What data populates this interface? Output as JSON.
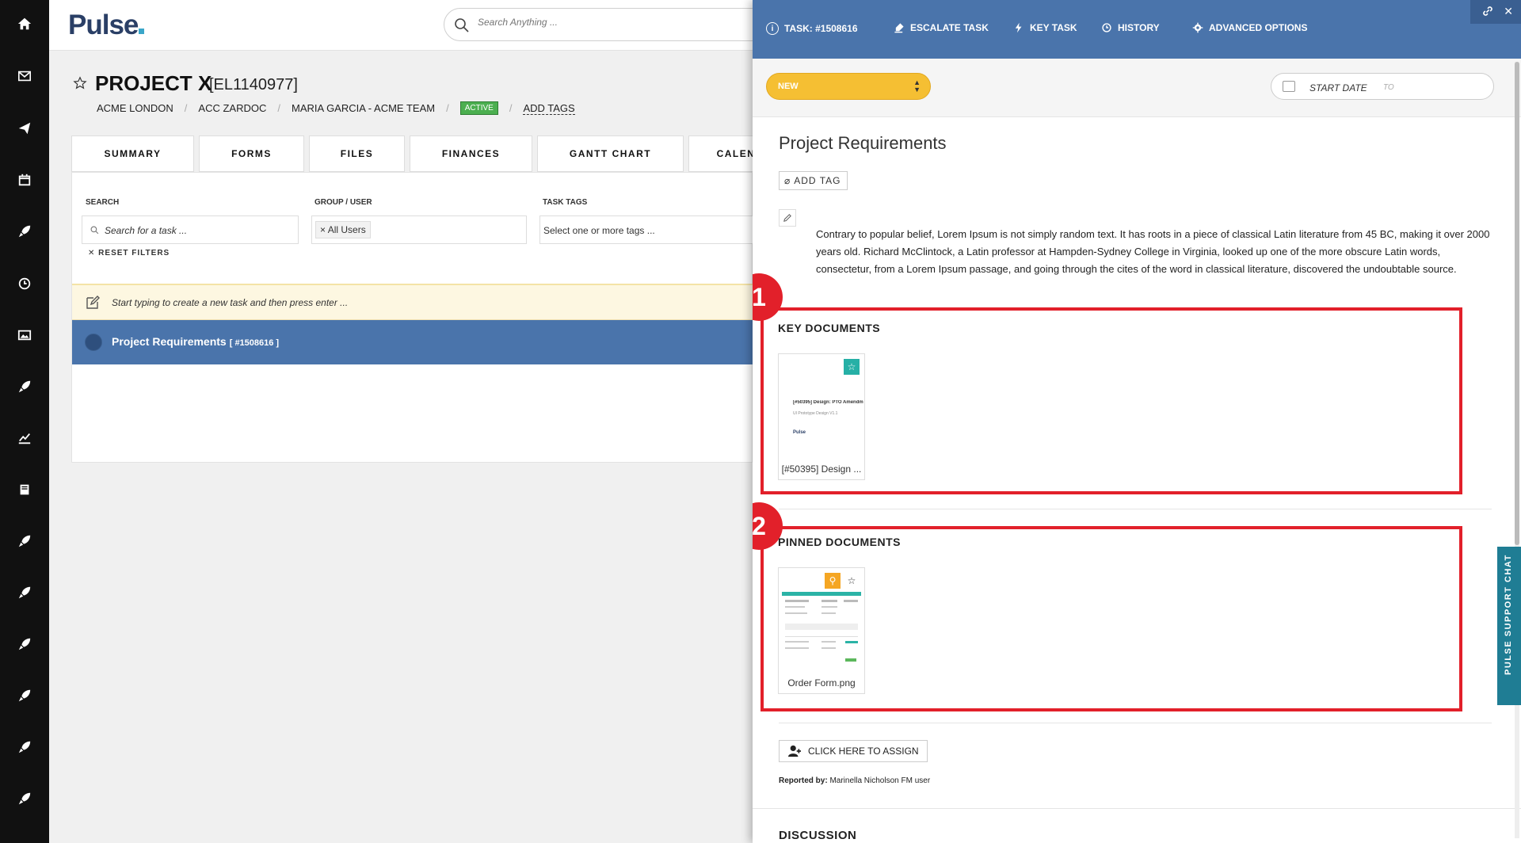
{
  "colors": {
    "header_blue": "#4a74ab",
    "status_yellow": "#f5bf33",
    "highlight_red": "#e2202a",
    "active_green": "#4caf50",
    "support_teal": "#1f7d94"
  },
  "rail_icons": [
    "home-icon",
    "mail-icon",
    "send-icon",
    "calendar-icon",
    "rocket-icon",
    "clock-icon",
    "image-icon",
    "rocket-icon",
    "chart-icon",
    "book-icon",
    "rocket-icon",
    "rocket-icon",
    "rocket-icon",
    "rocket-icon",
    "rocket-icon",
    "rocket-icon"
  ],
  "app": {
    "logo": "Pulse"
  },
  "search": {
    "placeholder": "Search Anything ..."
  },
  "project": {
    "title": "PROJECT X",
    "code": "[EL1140977]",
    "breadcrumbs": [
      "ACME LONDON",
      "ACC ZARDOC",
      "MARIA GARCIA - ACME TEAM"
    ],
    "status": "ACTIVE",
    "add_tags": "ADD TAGS"
  },
  "tabs": [
    "SUMMARY",
    "FORMS",
    "FILES",
    "FINANCES",
    "GANTT CHART",
    "CALEN"
  ],
  "filters": {
    "search_label": "SEARCH",
    "search_placeholder": "Search for a task ...",
    "group_label": "GROUP / USER",
    "group_value": "All Users",
    "tags_label": "TASK TAGS",
    "tags_placeholder": "Select one or more tags ...",
    "reset": "RESET FILTERS"
  },
  "new_task_hint": "Start typing to create a new task and then press enter ...",
  "task_row": {
    "title": "Project Requirements",
    "code": "[ #1508616 ]"
  },
  "panel": {
    "tabs": {
      "task": "TASK: #1508616",
      "escalate": "ESCALATE TASK",
      "key": "KEY TASK",
      "history": "HISTORY",
      "advanced": "ADVANCED OPTIONS"
    },
    "status": "NEW",
    "start_date": "START DATE",
    "to": "TO",
    "title": "Project Requirements",
    "add_tag": "ADD TAG",
    "description": "Contrary to popular belief, Lorem Ipsum is not simply random text. It has roots in a piece of classical Latin literature from 45 BC, making it over 2000 years old. Richard McClintock, a Latin professor at Hampden-Sydney College in Virginia, looked up one of the more obscure Latin words, consectetur, from a Lorem Ipsum passage, and going through the cites of the word in classical literature, discovered the undoubtable source.",
    "key_documents": {
      "callout": "1",
      "title": "KEY DOCUMENTS",
      "doc_name": "[#50395] Design ...",
      "doc_preview_title": "[#50395] Design: PTO Amendm",
      "doc_preview_sub": "UI Prototype Design V1.1",
      "doc_preview_link": "Pulse"
    },
    "pinned_documents": {
      "callout": "2",
      "title": "PINNED DOCUMENTS",
      "doc_name": "Order Form.png"
    },
    "assign": "CLICK HERE TO ASSIGN",
    "reported_label": "Reported by:",
    "reported_value": "Marinella Nicholson FM user",
    "discussion": "DISCUSSION",
    "support_chat": "PULSE SUPPORT CHAT"
  }
}
